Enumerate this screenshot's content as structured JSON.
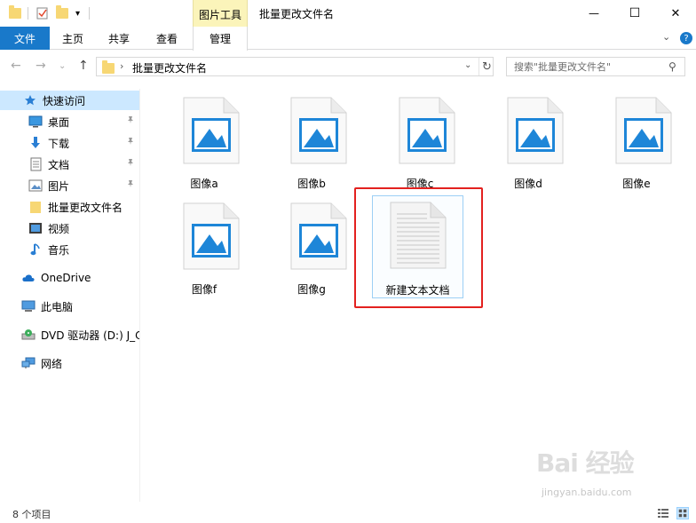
{
  "window": {
    "title": "批量更改文件名",
    "context_tab_group": "图片工具",
    "minimize_glyph": "—",
    "maximize_glyph": "☐",
    "close_glyph": "✕"
  },
  "quick_access_toolbar": {
    "customize_glyph": "▾"
  },
  "ribbon": {
    "tabs": [
      "文件",
      "主页",
      "共享",
      "查看",
      "管理"
    ],
    "collapse_glyph": "⌄",
    "help_glyph": "?"
  },
  "navigation": {
    "back_glyph": "←",
    "forward_glyph": "→",
    "recent_glyph": "⌄",
    "up_glyph": "↑",
    "breadcrumb_separator": "›",
    "breadcrumb": "批量更改文件名",
    "dropdown_glyph": "⌄",
    "refresh_glyph": "↻",
    "search_placeholder": "搜索\"批量更改文件名\"",
    "search_glyph": "⚲"
  },
  "sidebar": {
    "quick_access": "快速访问",
    "items": [
      {
        "label": "桌面",
        "icon": "desktop-icon",
        "pinned": true
      },
      {
        "label": "下载",
        "icon": "download-icon",
        "pinned": true
      },
      {
        "label": "文档",
        "icon": "document-icon",
        "pinned": true
      },
      {
        "label": "图片",
        "icon": "pictures-icon",
        "pinned": true
      },
      {
        "label": "批量更改文件名",
        "icon": "folder-icon",
        "pinned": false
      },
      {
        "label": "视频",
        "icon": "video-icon",
        "pinned": false
      },
      {
        "label": "音乐",
        "icon": "music-icon",
        "pinned": false
      }
    ],
    "pin_glyph": "📌",
    "onedrive": "OneDrive",
    "this_pc": "此电脑",
    "dvd": "DVD 驱动器 (D:) J_C",
    "network": "网络"
  },
  "files": [
    {
      "name": "图像a",
      "type": "image"
    },
    {
      "name": "图像b",
      "type": "image"
    },
    {
      "name": "图像c",
      "type": "image"
    },
    {
      "name": "图像d",
      "type": "image"
    },
    {
      "name": "图像e",
      "type": "image"
    },
    {
      "name": "图像f",
      "type": "image"
    },
    {
      "name": "图像g",
      "type": "image"
    },
    {
      "name": "新建文本文档",
      "type": "text"
    }
  ],
  "status": {
    "item_count": "8 个项目"
  },
  "watermark": {
    "brand": "Bai 经验",
    "url": "jingyan.baidu.com"
  },
  "colors": {
    "accent": "#1979ca",
    "context_tab": "#fbf4ba",
    "selection": "#cce8ff",
    "image_icon": "#1e86d8",
    "annotation": "#e3211f"
  }
}
